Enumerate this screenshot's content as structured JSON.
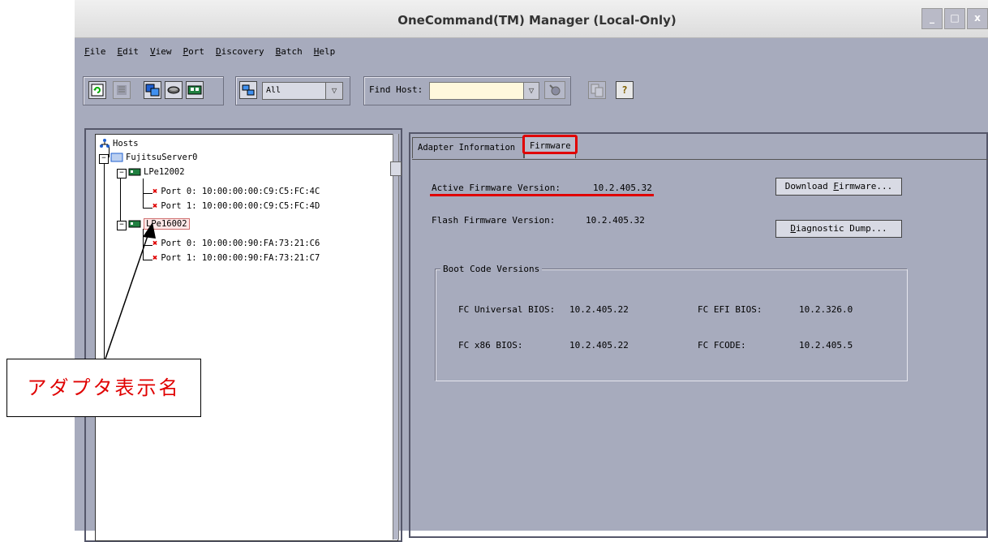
{
  "window": {
    "title": "OneCommand(TM) Manager (Local-Only)",
    "controls": [
      "_",
      "□",
      "x"
    ]
  },
  "menu": [
    {
      "u": "F",
      "rest": "ile"
    },
    {
      "u": "E",
      "rest": "dit"
    },
    {
      "u": "V",
      "rest": "iew"
    },
    {
      "u": "P",
      "rest": "ort"
    },
    {
      "u": "D",
      "rest": "iscovery"
    },
    {
      "u": "B",
      "rest": "atch"
    },
    {
      "u": "H",
      "rest": "elp"
    }
  ],
  "toolbar": {
    "filter_value": "All",
    "find_host_label": "Find Host:",
    "find_host_value": "",
    "help_glyph": "?"
  },
  "tree": {
    "root": "Hosts",
    "host": "FujitsuServer0",
    "adapters": [
      {
        "name": "LPe12002",
        "ports": [
          "Port 0: 10:00:00:00:C9:C5:FC:4C",
          "Port 1: 10:00:00:00:C9:C5:FC:4D"
        ]
      },
      {
        "name": "LPe16002",
        "ports": [
          "Port 0: 10:00:00:90:FA:73:21:C6",
          "Port 1: 10:00:00:90:FA:73:21:C7"
        ]
      }
    ]
  },
  "tabs": {
    "adapter_info": "Adapter Information",
    "firmware": "Firmware"
  },
  "firmware": {
    "active_label": "Active Firmware Version:",
    "active_value": "10.2.405.32",
    "flash_label": "Flash Firmware Version:",
    "flash_value": "10.2.405.32",
    "download_button": {
      "u": "",
      "pre": "Download ",
      "ul": "F",
      "post": "irmware..."
    },
    "diag_button": {
      "ul": "D",
      "post": "iagnostic Dump..."
    },
    "boot_title": "Boot Code Versions",
    "boot": [
      {
        "label": "FC Universal BIOS:",
        "value": "10.2.405.22"
      },
      {
        "label": "FC EFI BIOS:",
        "value": "10.2.326.0"
      },
      {
        "label": "FC x86 BIOS:",
        "value": "10.2.405.22"
      },
      {
        "label": "FC FCODE:",
        "value": "10.2.405.5"
      }
    ]
  },
  "annotation": {
    "text": "アダプタ表示名"
  },
  "colors": {
    "window_bg": "#a7abbd",
    "highlight": "#e00000",
    "find_bg": "#fff8dc"
  }
}
